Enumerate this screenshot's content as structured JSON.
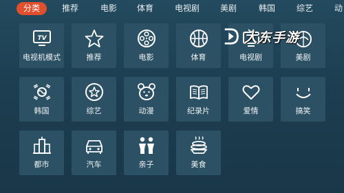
{
  "nav": {
    "tabs": [
      {
        "label": "分类",
        "active": true
      },
      {
        "label": "推荐"
      },
      {
        "label": "电影"
      },
      {
        "label": "体育"
      },
      {
        "label": "电视剧"
      },
      {
        "label": "美剧"
      },
      {
        "label": "韩国"
      },
      {
        "label": "综艺"
      },
      {
        "label": "动"
      }
    ]
  },
  "tiles": [
    {
      "label": "电视机模式",
      "icon": "tv-icon"
    },
    {
      "label": "推荐",
      "icon": "star-icon"
    },
    {
      "label": "电影",
      "icon": "film-reel-icon"
    },
    {
      "label": "体育",
      "icon": "basketball-icon"
    },
    {
      "label": "电视剧",
      "icon": "tv-series-icon"
    },
    {
      "label": "美剧",
      "icon": "us-drama-icon"
    },
    {
      "label": "韩国",
      "icon": "korea-flag-icon"
    },
    {
      "label": "综艺",
      "icon": "variety-star-icon"
    },
    {
      "label": "动漫",
      "icon": "bear-face-icon"
    },
    {
      "label": "纪录片",
      "icon": "open-book-icon"
    },
    {
      "label": "爱情",
      "icon": "heart-icon"
    },
    {
      "label": "搞笑",
      "icon": "smile-face-icon"
    },
    {
      "label": "都市",
      "icon": "city-building-icon"
    },
    {
      "label": "汽车",
      "icon": "car-icon"
    },
    {
      "label": "亲子",
      "icon": "parent-child-icon"
    },
    {
      "label": "美食",
      "icon": "food-dish-icon"
    }
  ],
  "watermark": {
    "text": "大东手游"
  },
  "colors": {
    "accent": "#e0502e",
    "tile": "#2d5164",
    "background": "#1f4256"
  }
}
